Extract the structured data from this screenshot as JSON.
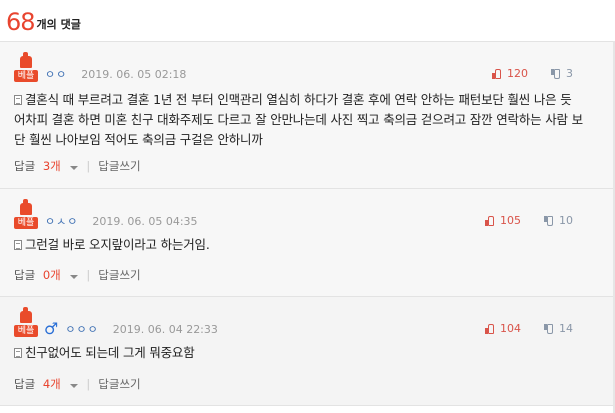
{
  "header": {
    "count": "68",
    "count_label": "개의 댓글"
  },
  "best_label": "베플",
  "reply_label": "답글",
  "reply_unit": "개",
  "write_reply_label": "답글쓰기",
  "separator": "|",
  "comments": [
    {
      "nickname": "ㅇㅇ",
      "date": "2019. 06. 05 02:18",
      "up": "120",
      "down": "3",
      "text": "결혼식 때 부르려고 결혼 1년 전 부터 인맥관리 열심히 하다가 결혼 후에 연락 안하는 패턴보단 훨씬 나은 듯 어차피 결혼 하면 미혼 친구 대화주제도 다르고 잘 안만나는데 사진 찍고 축의금 걷으려고 잠깐 연락하는 사람 보단 훨씬 나아보임 적어도 축의금 구걸은 안하니까",
      "replies": "3"
    },
    {
      "nickname": "ㅇㅅㅇ",
      "date": "2019. 06. 05 04:35",
      "up": "105",
      "down": "10",
      "text": "그런걸 바로 오지랖이라고 하는거임.",
      "replies": "0"
    },
    {
      "gender_symbol": "♂",
      "nickname": "ㅇㅇㅇ",
      "date": "2019. 06. 04 22:33",
      "up": "104",
      "down": "14",
      "text": "친구없어도 되는데 그게 뭐중요함",
      "replies": "4"
    }
  ],
  "colors": {
    "accent": "#e8442f",
    "badge": "#e94b2b",
    "nickname": "#3d6fb3",
    "male": "#2a6fd6",
    "downvote": "#8a97a8"
  },
  "icons": [
    "thumbs-up-icon",
    "thumbs-down-icon",
    "document-icon",
    "caret-down-icon",
    "male-icon"
  ]
}
